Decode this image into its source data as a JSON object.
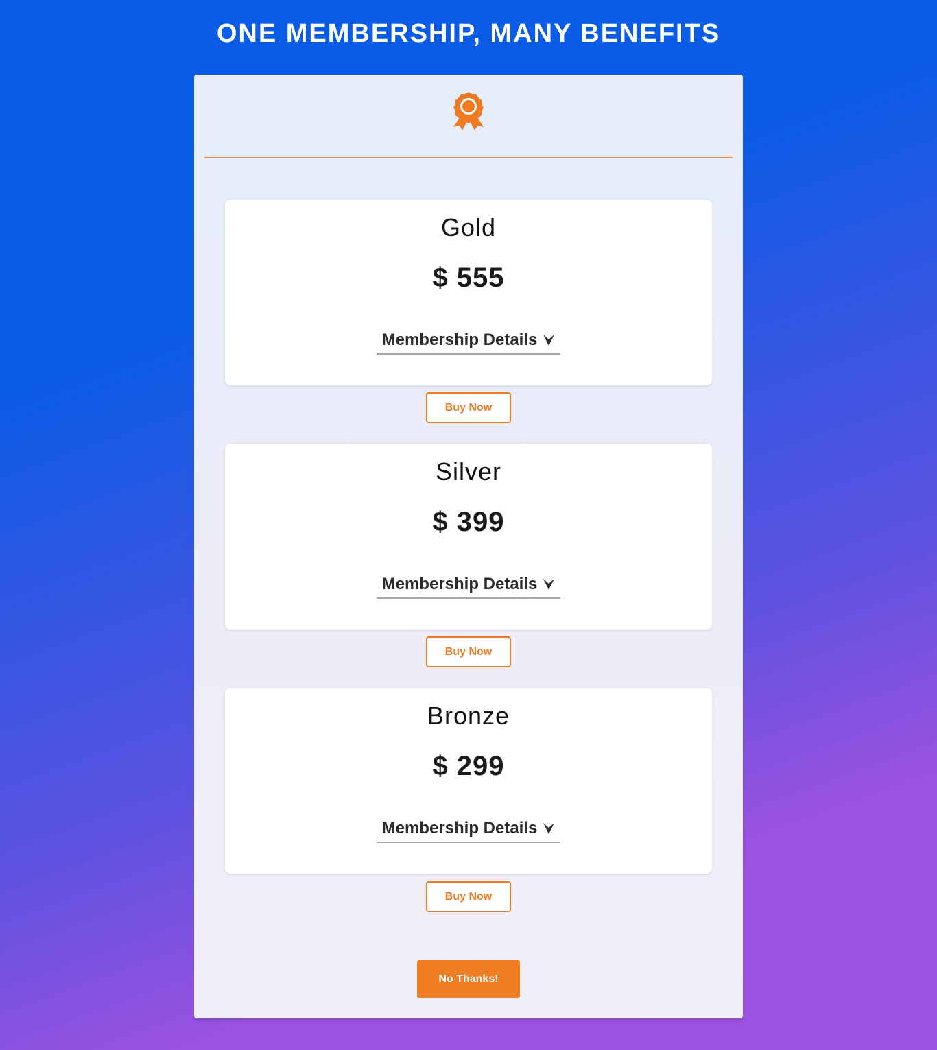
{
  "header": {
    "title": "ONE MEMBERSHIP, MANY BENEFITS"
  },
  "panel": {
    "badge_icon": "award-ribbon-icon",
    "accent_color": "#f07a22"
  },
  "plans": [
    {
      "name": "Gold",
      "price": "$ 555",
      "details_label": "Membership Details",
      "details_icon": "chevron-down-icon",
      "buy_label": "Buy Now"
    },
    {
      "name": "Silver",
      "price": "$ 399",
      "details_label": "Membership Details",
      "details_icon": "chevron-down-icon",
      "buy_label": "Buy Now"
    },
    {
      "name": "Bronze",
      "price": "$ 299",
      "details_label": "Membership Details",
      "details_icon": "chevron-down-icon",
      "buy_label": "Buy Now"
    }
  ],
  "footer": {
    "decline_label": "No Thanks!"
  }
}
